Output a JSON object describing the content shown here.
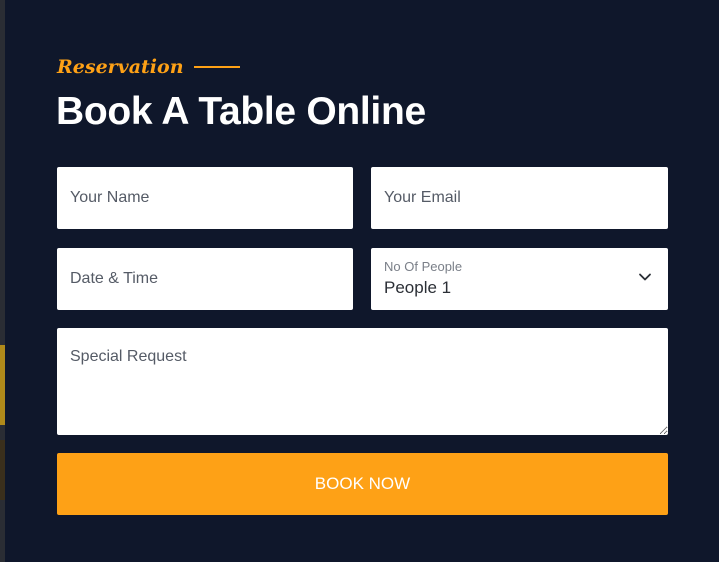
{
  "section": {
    "kicker": "Reservation",
    "title": "Book A Table Online"
  },
  "form": {
    "name_placeholder": "Your Name",
    "email_placeholder": "Your Email",
    "datetime_placeholder": "Date & Time",
    "people_label": "No Of People",
    "people_value": "People 1",
    "request_placeholder": "Special Request",
    "submit_label": "BOOK NOW"
  },
  "colors": {
    "background": "#0F172B",
    "accent": "#FEA116",
    "field_bg": "#FFFFFF"
  },
  "icons": {
    "select_arrow": "chevron-down-icon"
  }
}
